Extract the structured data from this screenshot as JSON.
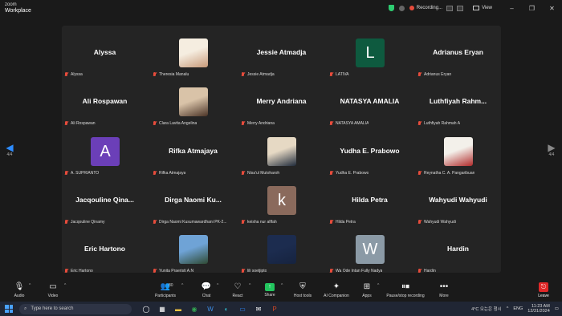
{
  "app": {
    "brand_top": "zoom",
    "brand_bottom": "Workplace"
  },
  "titlebar": {
    "recording_label": "Recording...",
    "view_label": "View"
  },
  "nav": {
    "page_left": "4/4",
    "page_right": "4/4"
  },
  "participants": [
    {
      "big_name": "Alyssa",
      "label": "Alyssa",
      "avatar": null
    },
    {
      "big_name": "",
      "label": "Theresia Manalu",
      "avatar": {
        "type": "photo",
        "colors": [
          "#f5ede0",
          "#c79a7a"
        ]
      }
    },
    {
      "big_name": "Jessie Atmadja",
      "label": "Jessie Atmadja",
      "avatar": null
    },
    {
      "big_name": "",
      "label": "LATIVA",
      "avatar": {
        "type": "letter",
        "letter": "L",
        "color": "#0e5a3f"
      }
    },
    {
      "big_name": "Adrianus Eryan",
      "label": "Adrianus Eryan",
      "avatar": null
    },
    {
      "big_name": "Ali Rospawan",
      "label": "Ali Rospawan",
      "avatar": null
    },
    {
      "big_name": "",
      "label": "Clara Lavita Angelina",
      "avatar": {
        "type": "photo",
        "colors": [
          "#d9c3a8",
          "#4a3326"
        ]
      }
    },
    {
      "big_name": "Merry Andriana",
      "label": "Merry Andriana",
      "avatar": null
    },
    {
      "big_name": "NATASYA AMALIA",
      "label": "NATASYA AMALIA",
      "avatar": null
    },
    {
      "big_name": "Luthfiyah Rahm...",
      "label": "Luthfiyah Rahmah A",
      "avatar": null
    },
    {
      "big_name": "",
      "label": "A. SUPRIANTO",
      "avatar": {
        "type": "letter",
        "letter": "A",
        "color": "#6b3fb8"
      }
    },
    {
      "big_name": "Rifka Atmajaya",
      "label": "Rifka Atmajaya",
      "avatar": null
    },
    {
      "big_name": "",
      "label": "Nisa'ul Mutoharoh",
      "avatar": {
        "type": "photo",
        "colors": [
          "#e6d9c4",
          "#1f2a3a"
        ]
      }
    },
    {
      "big_name": "Yudha E. Prabowo",
      "label": "Yudha E. Prabowo",
      "avatar": null
    },
    {
      "big_name": "",
      "label": "Reynatha C. A. Pangaribuan",
      "avatar": {
        "type": "photo",
        "colors": [
          "#f3f0ea",
          "#b02a2a"
        ]
      }
    },
    {
      "big_name": "Jacqouline Qina...",
      "label": "Jacqouline Qinamy",
      "avatar": null
    },
    {
      "big_name": "Dirga Naomi Ku...",
      "label": "Dirga Naomi Kusumawardhani PK-2...",
      "avatar": null
    },
    {
      "big_name": "",
      "label": "keisha nur afifah",
      "avatar": {
        "type": "letter",
        "letter": "k",
        "color": "#8a6a5c"
      }
    },
    {
      "big_name": "Hilda Petra",
      "label": "Hilda Petra",
      "avatar": null
    },
    {
      "big_name": "Wahyudi Wahyudi",
      "label": "Wahyudi Wahyudi",
      "avatar": null
    },
    {
      "big_name": "Eric Hartono",
      "label": "Eric Hartono",
      "avatar": null
    },
    {
      "big_name": "",
      "label": "Yunita Praeristi A.N",
      "avatar": {
        "type": "photo",
        "colors": [
          "#6fa3d6",
          "#2f4a33"
        ]
      }
    },
    {
      "big_name": "",
      "label": "lili soetjipto",
      "avatar": {
        "type": "photo",
        "colors": [
          "#1c2c4f",
          "#16233f"
        ]
      }
    },
    {
      "big_name": "",
      "label": "Wa Ode Intan Fully Nadya",
      "avatar": {
        "type": "letter",
        "letter": "W",
        "color": "#8b9aa6"
      }
    },
    {
      "big_name": "Hardin",
      "label": "Hardin",
      "avatar": null
    }
  ],
  "toolbar": {
    "audio": "Audio",
    "video": "Video",
    "participants": "Participants",
    "participants_count": "80",
    "chat": "Chat",
    "react": "React",
    "share": "Share",
    "host_tools": "Host tools",
    "ai_companion": "AI Companion",
    "apps": "Apps",
    "record": "Pause/stop recording",
    "more": "More",
    "leave": "Leave"
  },
  "taskbar": {
    "search_placeholder": "Type here to search",
    "weather": "4°C 오는은 청시",
    "lang": "ENG",
    "time": "11:23 AM",
    "date": "12/31/2024"
  }
}
